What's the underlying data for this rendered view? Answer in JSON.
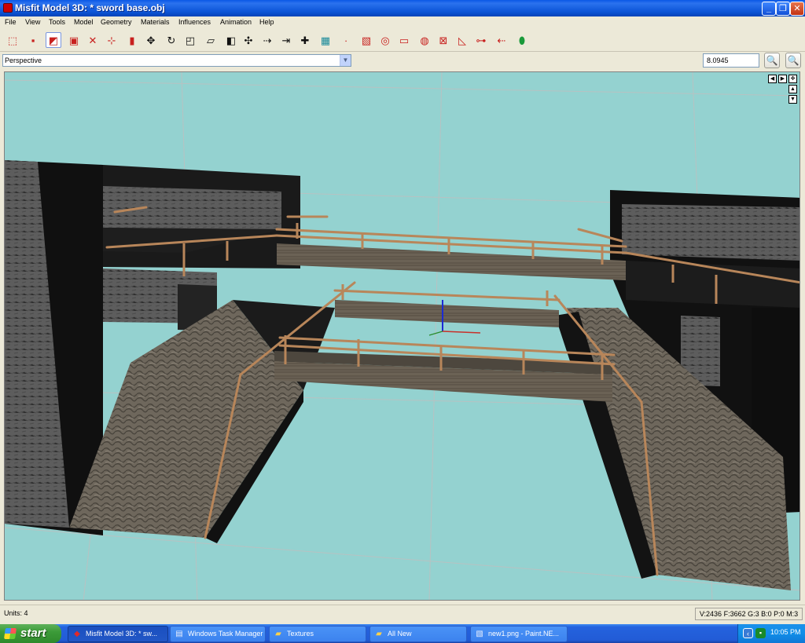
{
  "window": {
    "title": "Misfit Model 3D: * sword base.obj",
    "buttons": {
      "minimize": "_",
      "maximize": "❐",
      "close": "✕"
    }
  },
  "menu": [
    "File",
    "View",
    "Tools",
    "Model",
    "Geometry",
    "Materials",
    "Influences",
    "Animation",
    "Help"
  ],
  "toolbar": {
    "tools": [
      {
        "name": "select-vertices-tool",
        "glyph": "⬚"
      },
      {
        "name": "select-faces-tool",
        "glyph": "▪"
      },
      {
        "name": "select-connected-tool",
        "glyph": "◩"
      },
      {
        "name": "select-groups-tool",
        "glyph": "▣"
      },
      {
        "name": "select-bone-joints-tool",
        "glyph": "✕"
      },
      {
        "name": "select-points-tool",
        "glyph": "⊹"
      },
      {
        "name": "select-projections-tool",
        "glyph": "▮"
      },
      {
        "name": "move-tool",
        "glyph": "✥"
      },
      {
        "name": "rotate-tool",
        "glyph": "↻"
      },
      {
        "name": "scale-tool",
        "glyph": "◰"
      },
      {
        "name": "shear-tool",
        "glyph": "▱"
      },
      {
        "name": "extrude-tool",
        "glyph": "◧"
      },
      {
        "name": "attract-tool",
        "glyph": "✣"
      },
      {
        "name": "drag-vertex-tool",
        "glyph": "⇢"
      },
      {
        "name": "drag-face-tool",
        "glyph": "⇥"
      },
      {
        "name": "create-bone-tool",
        "glyph": "✚"
      },
      {
        "name": "paint-texture-tool",
        "glyph": "▦"
      },
      {
        "name": "create-vertex-tool",
        "glyph": "∙"
      },
      {
        "name": "create-rectangle-tool",
        "glyph": "▧"
      },
      {
        "name": "create-sphere-tool",
        "glyph": "◎"
      },
      {
        "name": "create-cylinder-tool",
        "glyph": "▭"
      },
      {
        "name": "create-torus-tool",
        "glyph": "◍"
      },
      {
        "name": "create-cube-tool",
        "glyph": "⊠"
      },
      {
        "name": "create-polygon-tool",
        "glyph": "◺"
      },
      {
        "name": "create-ellipse-tool",
        "glyph": "⊶"
      },
      {
        "name": "create-point-tool",
        "glyph": "⇠"
      },
      {
        "name": "create-projection-tool",
        "glyph": "⬮"
      }
    ]
  },
  "view": {
    "projection": "Perspective",
    "zoom": "8.0945",
    "zoom_in_icon": "🔍",
    "zoom_out_icon": "🔍"
  },
  "nav": {
    "left": "◀",
    "right": "▶",
    "pan": "✥",
    "up": "▲",
    "down": "▼"
  },
  "status": {
    "units": "Units: 4",
    "stats": "V:2436 F:3662 G:3 B:0 P:0 M:3"
  },
  "taskbar": {
    "start": "start",
    "tasks": [
      {
        "label": "Misfit Model 3D: * sw...",
        "icon": "◆"
      },
      {
        "label": "Windows Task Manager",
        "icon": "▤"
      },
      {
        "label": "Textures",
        "icon": "▰"
      },
      {
        "label": "All New",
        "icon": "▰"
      },
      {
        "label": "new1.png - Paint.NE...",
        "icon": "▧"
      }
    ],
    "clock": "10:05 PM"
  },
  "colors": {
    "viewport_bg": "#94d2d0",
    "title_blue": "#0a58e6",
    "railing": "#b8865a"
  }
}
